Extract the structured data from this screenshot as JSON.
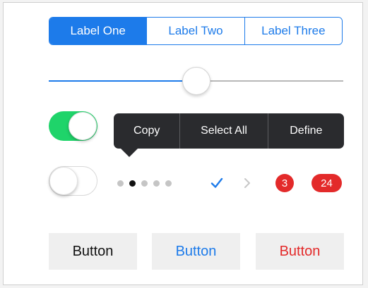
{
  "segmented_control": {
    "segments": [
      {
        "label": "Label One",
        "selected": true
      },
      {
        "label": "Label Two",
        "selected": false
      },
      {
        "label": "Label Three",
        "selected": false
      }
    ]
  },
  "slider": {
    "value": 0.5
  },
  "toggles": [
    {
      "state": "on"
    },
    {
      "state": "off"
    }
  ],
  "edit_menu": {
    "items": [
      "Copy",
      "Select All",
      "Define"
    ]
  },
  "page_control": {
    "count": 5,
    "current_index": 1
  },
  "icons": {
    "checkmark": "checkmark-icon",
    "chevron": "chevron-right-icon"
  },
  "badges": [
    "3",
    "24"
  ],
  "buttons": [
    {
      "label": "Button",
      "style": "default"
    },
    {
      "label": "Button",
      "style": "blue"
    },
    {
      "label": "Button",
      "style": "red"
    }
  ],
  "colors": {
    "accent": "#1d7bea",
    "toggle_on": "#1fd46a",
    "destructive": "#e32a2a",
    "menu_bg": "#2a2b2e"
  }
}
